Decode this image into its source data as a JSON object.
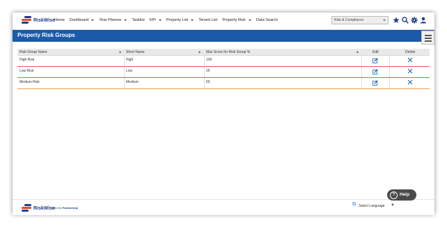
{
  "brand": {
    "name": "RiskWise"
  },
  "nav": {
    "items": [
      {
        "label": "Home",
        "dropdown": false
      },
      {
        "label": "Dashboard",
        "dropdown": true
      },
      {
        "label": "Year Planner",
        "dropdown": true
      },
      {
        "label": "Tasklist",
        "dropdown": false
      },
      {
        "label": "KPI",
        "dropdown": true
      },
      {
        "label": "Property List",
        "dropdown": true
      },
      {
        "label": "Tenant List",
        "dropdown": false
      },
      {
        "label": "Property Risk",
        "dropdown": true
      },
      {
        "label": "Data Search",
        "dropdown": false
      }
    ]
  },
  "module_select": {
    "value": "Risk & Compliance"
  },
  "toolbar": {
    "icons": [
      "star-icon",
      "search-icon",
      "gear-icon",
      "user-icon"
    ]
  },
  "page": {
    "title": "Property Risk Groups"
  },
  "table": {
    "headers": {
      "name": "Risk Group Name",
      "short": "Short Name",
      "max": "Max Score for Risk Group %",
      "edit": "Edit",
      "delete": "Delete"
    },
    "rows": [
      {
        "name": "High Risk",
        "short": "High",
        "max": "100",
        "color": "#e05a5a"
      },
      {
        "name": "Low Risk",
        "short": "Low",
        "max": "25",
        "color": "#3cae5c"
      },
      {
        "name": "Medium Risk",
        "short": "Medium",
        "max": "50",
        "color": "#f0a040"
      }
    ]
  },
  "footer": {
    "brand": "RiskWise",
    "tag_prefix": "from the",
    "tag_partner": "Partnership",
    "translate": "Select Language"
  },
  "help": {
    "label": "Help"
  },
  "colors": {
    "brand_blue": "#1a5aa8",
    "dark_blue": "#1f3c8a"
  }
}
